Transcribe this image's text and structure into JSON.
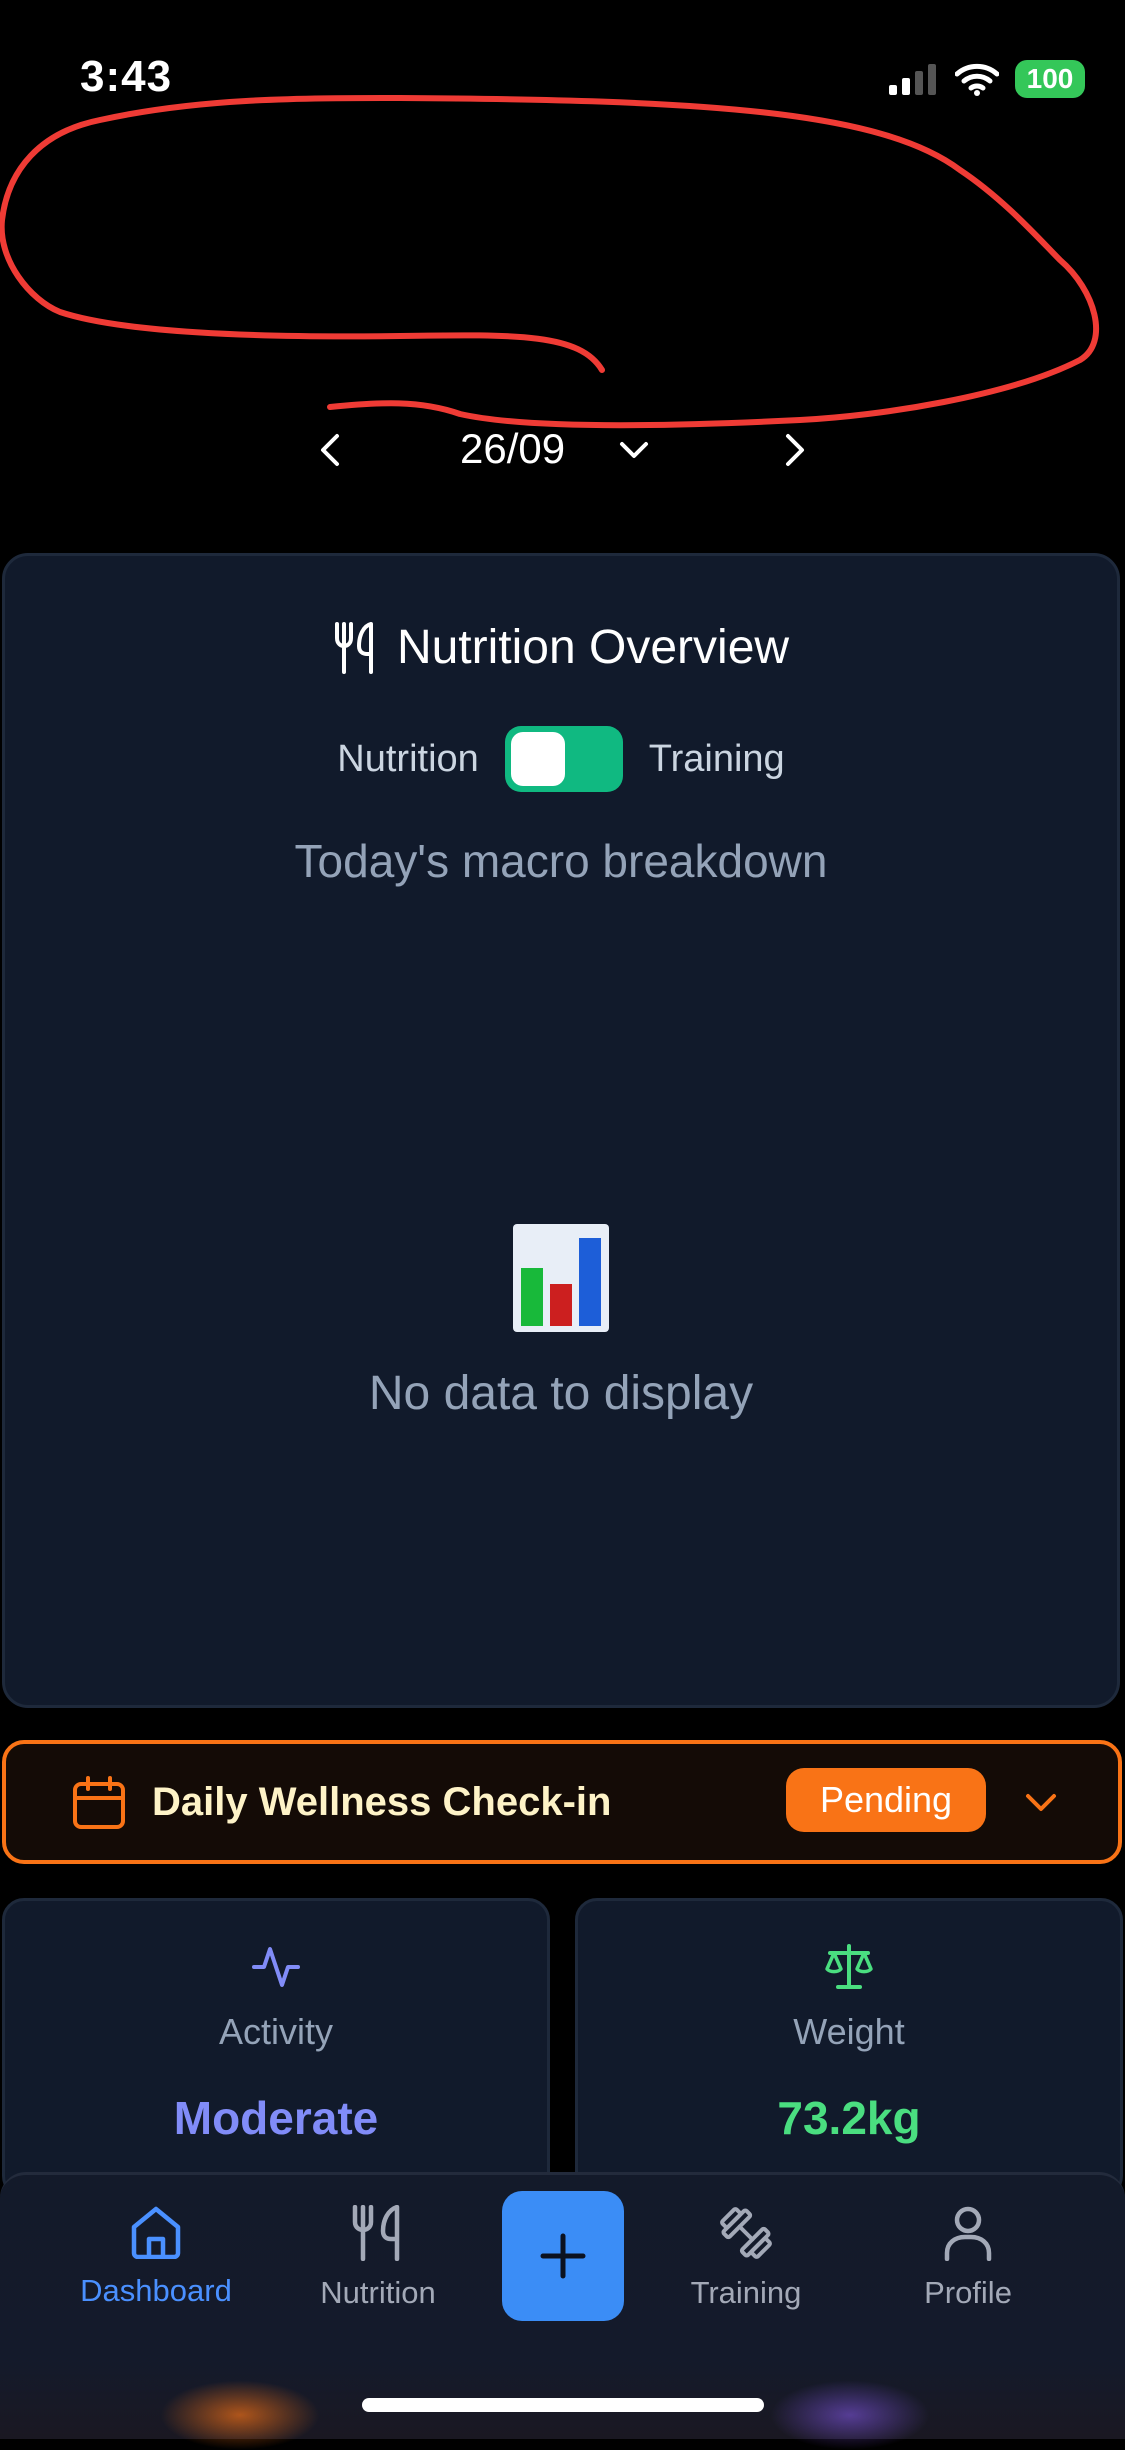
{
  "status_bar": {
    "time": "3:43",
    "battery": "100"
  },
  "date_nav": {
    "date": "26/09"
  },
  "overview_card": {
    "title": "Nutrition Overview",
    "toggle_left": "Nutrition",
    "toggle_right": "Training",
    "subtitle": "Today's macro breakdown",
    "empty_text": "No data to display"
  },
  "checkin": {
    "title": "Daily Wellness Check-in",
    "badge": "Pending"
  },
  "stats": {
    "activity": {
      "label": "Activity",
      "value": "Moderate",
      "color": "#818cf8"
    },
    "weight": {
      "label": "Weight",
      "value": "73.2kg",
      "color": "#4ade80"
    }
  },
  "bottom_nav": {
    "dashboard": "Dashboard",
    "nutrition": "Nutrition",
    "training": "Training",
    "profile": "Profile"
  },
  "colors": {
    "accent": "#3b8df6",
    "orange": "#f97316",
    "green": "#10b981",
    "card_bg": "#111a2b"
  }
}
